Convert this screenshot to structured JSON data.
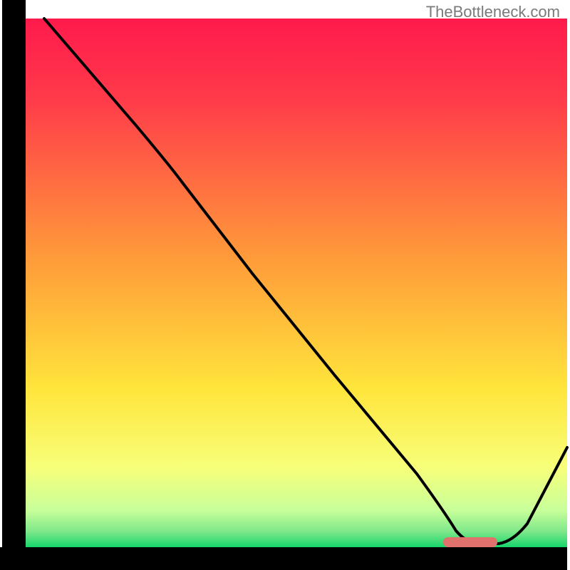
{
  "watermark": "TheBottleneck.com",
  "chart_data": {
    "type": "line",
    "title": "",
    "xlabel": "",
    "ylabel": "",
    "xlim": [
      0,
      100
    ],
    "ylim": [
      0,
      100
    ],
    "background_gradient": {
      "top": "#ff1a4c",
      "mid": "#ffe53b",
      "bottom": "#16d66c"
    },
    "series": [
      {
        "name": "bottleneck-curve",
        "x": [
          4,
          20,
          27,
          40,
          55,
          70,
          78,
          85,
          100
        ],
        "y": [
          100,
          80,
          73,
          56,
          37,
          18,
          4,
          1,
          20
        ]
      }
    ],
    "marker": {
      "name": "optimal-range",
      "x_start": 77,
      "x_end": 86,
      "y": 1.5,
      "color": "#e0716d"
    },
    "axes": {
      "left": true,
      "bottom": true,
      "ticks": "none"
    }
  }
}
